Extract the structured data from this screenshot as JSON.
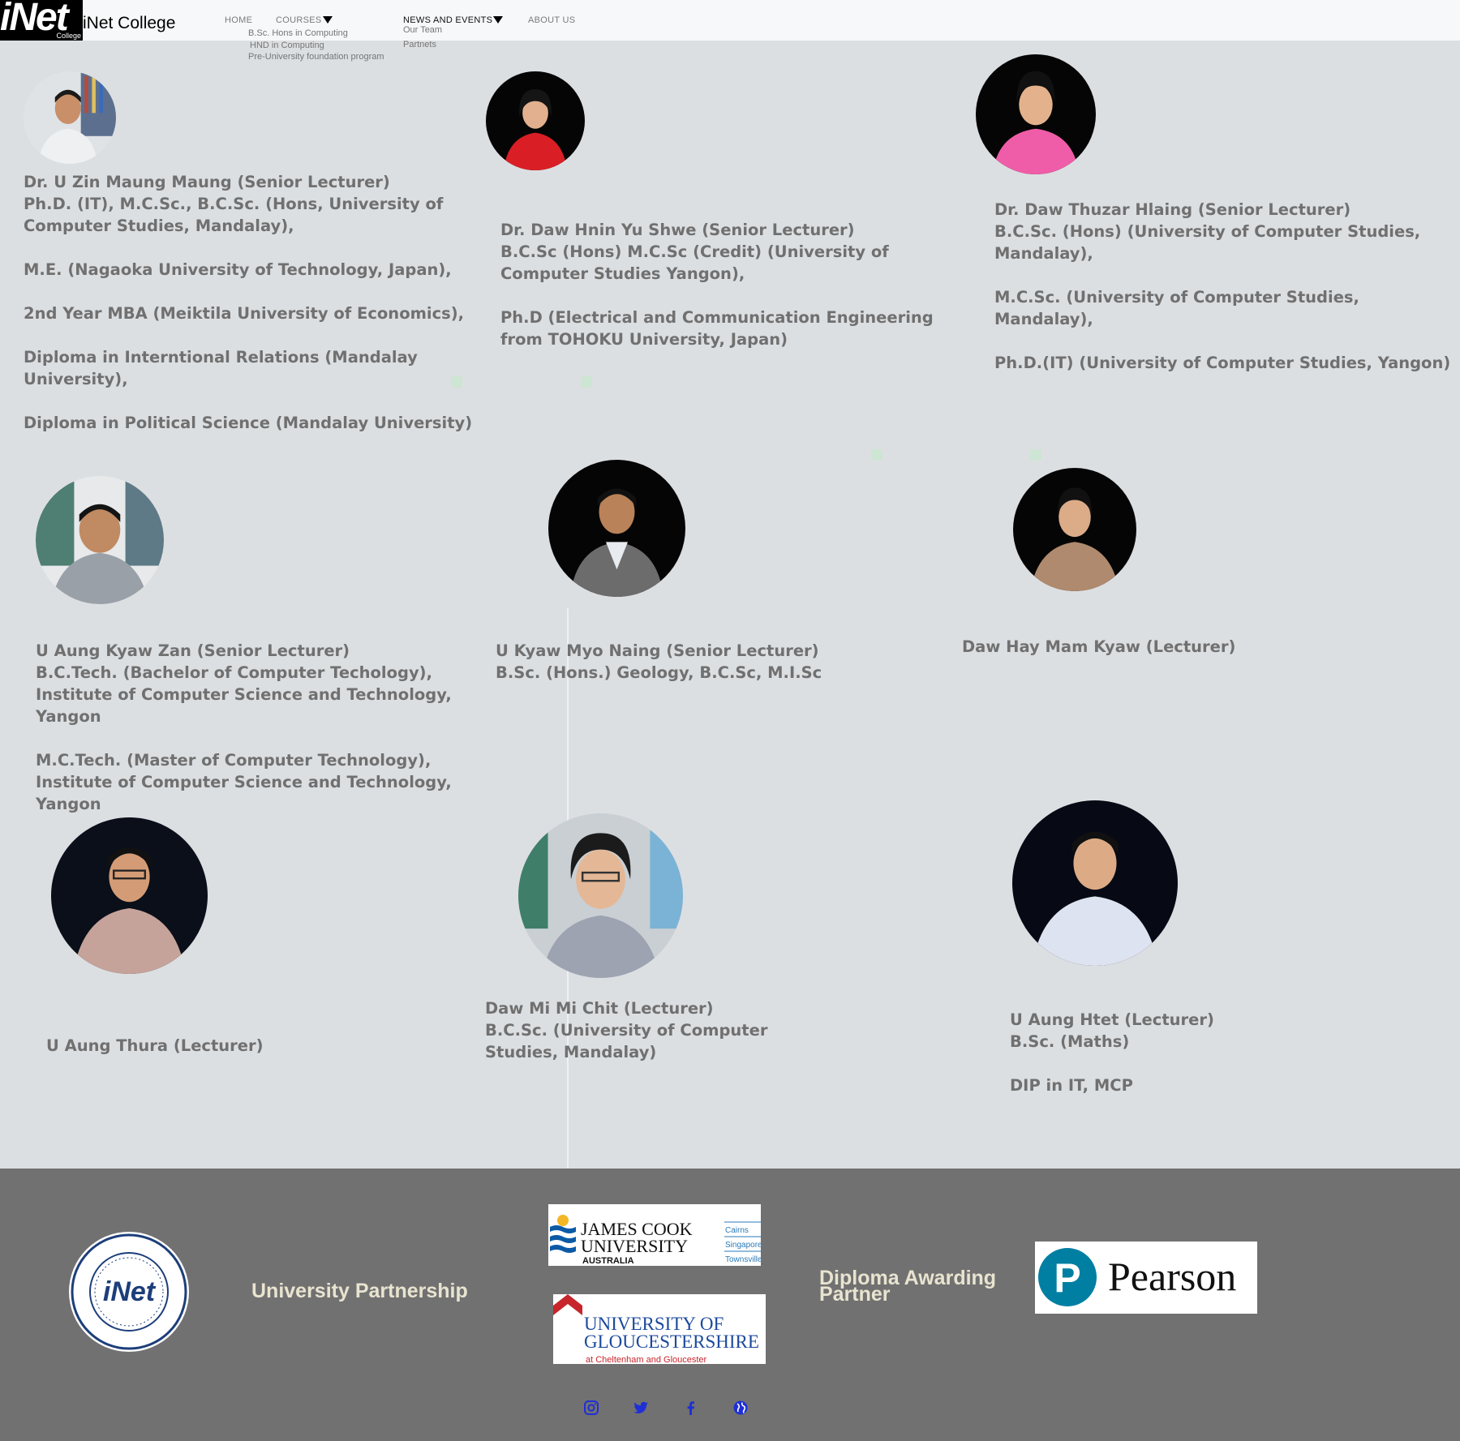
{
  "header": {
    "logo_text": "iNet",
    "logo_sub": "College",
    "site_title": "iNet College",
    "nav": {
      "home": "HOME",
      "courses": "COURSES",
      "news": "NEWS AND EVENTS",
      "about": "ABOUT US"
    },
    "courses_menu": [
      "B.Sc. Hons in Computing",
      "HND in Computing",
      "Pre-University foundation program"
    ],
    "news_menu": [
      "Our Team",
      "Partnets"
    ]
  },
  "staff": [
    {
      "lines": [
        "Dr. U Zin Maung Maung (Senior Lecturer)",
        "Ph.D. (IT), M.C.Sc., B.C.Sc. (Hons, University of",
        "Computer Studies, Mandalay),",
        "",
        "M.E. (Nagaoka University of Technology, Japan),",
        "",
        "2nd Year MBA (Meiktila University of Economics),",
        "",
        "Diploma in Interntional Relations (Mandalay",
        "University),",
        "",
        "Diploma in Political Science (Mandalay University)"
      ]
    },
    {
      "lines": [
        "Dr. Daw Hnin Yu Shwe (Senior Lecturer)",
        "B.C.Sc (Hons) M.C.Sc (Credit) (University of",
        "Computer Studies Yangon),",
        "",
        "Ph.D (Electrical and Communication Engineering",
        "from TOHOKU University, Japan)"
      ]
    },
    {
      "lines": [
        "Dr. Daw Thuzar Hlaing (Senior Lecturer)",
        "B.C.Sc. (Hons) (University of Computer Studies, Mandalay),",
        "",
        "M.C.Sc. (University of Computer Studies, Mandalay),",
        "",
        "Ph.D.(IT) (University of Computer Studies, Yangon)"
      ]
    },
    {
      "lines": [
        "U Aung Kyaw Zan (Senior Lecturer)",
        "B.C.Tech. (Bachelor of Computer Techology),",
        "Institute of Computer Science and Technology,",
        "Yangon",
        "",
        "M.C.Tech. (Master of Computer Technology),",
        "Institute of Computer Science and Technology,",
        "Yangon"
      ]
    },
    {
      "lines": [
        "U Kyaw Myo Naing (Senior Lecturer)",
        "B.Sc. (Hons.) Geology, B.C.Sc, M.I.Sc"
      ]
    },
    {
      "lines": [
        "Daw Hay Mam Kyaw (Lecturer)"
      ]
    },
    {
      "lines": [
        "U Aung Thura (Lecturer)"
      ]
    },
    {
      "lines": [
        "Daw Mi Mi Chit (Lecturer)",
        "B.C.Sc. (University of Computer",
        "Studies, Mandalay)"
      ]
    },
    {
      "lines": [
        "U Aung Htet (Lecturer)",
        "B.Sc. (Maths)",
        "",
        "DIP in IT, MCP"
      ]
    }
  ],
  "footer": {
    "emblem_text": "iNet",
    "emblem_ring": "College for Professional Education",
    "university_label": "University Partnership",
    "diploma_label_1": "Diploma Awarding",
    "diploma_label_2": "Partner",
    "jcu": {
      "line1": "JAMES COOK",
      "line2": "UNIVERSITY",
      "line3": "AUSTRALIA",
      "campuses": [
        "Cairns",
        "Singapore",
        "Townsville"
      ]
    },
    "glos": {
      "line1": "UNIVERSITY OF",
      "line2": "GLOUCESTERSHIRE",
      "line3": "at Cheltenham and Gloucester"
    },
    "pearson": {
      "mark": "P",
      "name": "Pearson"
    },
    "social": [
      "instagram-icon",
      "twitter-icon",
      "facebook-icon",
      "globe-icon"
    ]
  },
  "colors": {
    "page_bg": "#dcdfe2",
    "footer_bg": "#717171",
    "bio_text": "#707070",
    "footer_label": "#e9e4d0",
    "social_icon": "#1f2fd6",
    "pearson_blue": "#007fa3"
  }
}
